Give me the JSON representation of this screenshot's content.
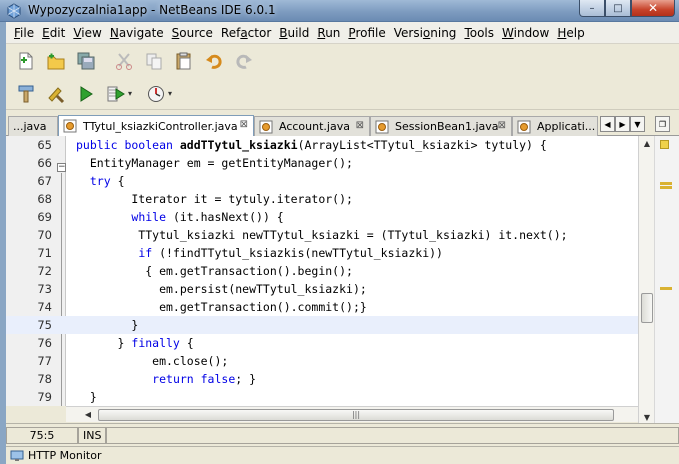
{
  "window": {
    "title": "Wypozyczalnia1app - NetBeans IDE 6.0.1",
    "minimize": "–",
    "maximize": "□",
    "close": "✕"
  },
  "menu": [
    {
      "mnemonic": "F",
      "rest": "ile"
    },
    {
      "mnemonic": "E",
      "rest": "dit"
    },
    {
      "mnemonic": "V",
      "rest": "iew"
    },
    {
      "mnemonic": "N",
      "rest": "avigate"
    },
    {
      "mnemonic": "S",
      "rest": "ource"
    },
    {
      "pre": "Ref",
      "mnemonic": "a",
      "rest": "ctor"
    },
    {
      "mnemonic": "B",
      "rest": "uild"
    },
    {
      "mnemonic": "R",
      "rest": "un"
    },
    {
      "mnemonic": "P",
      "rest": "rofile"
    },
    {
      "pre": "Versi",
      "mnemonic": "o",
      "rest": "ning"
    },
    {
      "mnemonic": "T",
      "rest": "ools"
    },
    {
      "mnemonic": "W",
      "rest": "indow"
    },
    {
      "mnemonic": "H",
      "rest": "elp"
    }
  ],
  "toolbar": {
    "row1": [
      "new-file-icon",
      "new-project-icon",
      "save-all-icon",
      "cut-icon",
      "copy-icon",
      "paste-icon",
      "undo-icon",
      "redo-icon"
    ],
    "row2": [
      "build-icon",
      "clean-build-icon",
      "run-icon",
      "debug-icon",
      "profile-icon"
    ]
  },
  "tabs": [
    {
      "label": "...java"
    },
    {
      "label": "TTytul_ksiazkiController.java",
      "active": true,
      "close": "⊠"
    },
    {
      "label": "Account.java",
      "close": "⊠"
    },
    {
      "label": "SessionBean1.java",
      "close": "⊠"
    },
    {
      "label": "Applicati..."
    }
  ],
  "editor": {
    "current_line": 75,
    "lines": [
      {
        "n": "65",
        "parts": [
          [
            "kw",
            "public boolean "
          ],
          [
            "b",
            "addTTytul_ksiazki"
          ],
          [
            "t",
            "(ArrayList<TTytul_ksiazki> tytuly) {"
          ]
        ]
      },
      {
        "n": "66",
        "parts": [
          [
            "t",
            "  EntityManager em = getEntityManager();"
          ]
        ]
      },
      {
        "n": "67",
        "parts": [
          [
            "t",
            "  "
          ],
          [
            "kw",
            "try"
          ],
          [
            "t",
            " {"
          ]
        ]
      },
      {
        "n": "68",
        "parts": [
          [
            "t",
            "        Iterator it = tytuly.iterator();"
          ]
        ]
      },
      {
        "n": "69",
        "parts": [
          [
            "t",
            "        "
          ],
          [
            "kw",
            "while"
          ],
          [
            "t",
            " (it.hasNext()) {"
          ]
        ]
      },
      {
        "n": "70",
        "parts": [
          [
            "t",
            "         TTytul_ksiazki newTTytul_ksiazki = (TTytul_ksiazki) it.next();"
          ]
        ]
      },
      {
        "n": "71",
        "parts": [
          [
            "t",
            "         "
          ],
          [
            "kw",
            "if"
          ],
          [
            "t",
            " (!findTTytul_ksiazkis(newTTytul_ksiazki))"
          ]
        ]
      },
      {
        "n": "72",
        "parts": [
          [
            "t",
            "          { em.getTransaction().begin();"
          ]
        ]
      },
      {
        "n": "73",
        "parts": [
          [
            "t",
            "            em.persist(newTTytul_ksiazki);"
          ]
        ]
      },
      {
        "n": "74",
        "parts": [
          [
            "t",
            "            em.getTransaction().commit();}"
          ]
        ]
      },
      {
        "n": "75",
        "parts": [
          [
            "t",
            "        }"
          ]
        ]
      },
      {
        "n": "76",
        "parts": [
          [
            "t",
            "      } "
          ],
          [
            "kw",
            "finally"
          ],
          [
            "t",
            " {"
          ]
        ]
      },
      {
        "n": "77",
        "parts": [
          [
            "t",
            "           em.close();"
          ]
        ]
      },
      {
        "n": "78",
        "parts": [
          [
            "t",
            "           "
          ],
          [
            "kw",
            "return false"
          ],
          [
            "t",
            "; }"
          ]
        ]
      },
      {
        "n": "79",
        "parts": [
          [
            "t",
            "  }"
          ]
        ]
      }
    ]
  },
  "statusbar": {
    "position": "75:5",
    "mode": "INS"
  },
  "bottom_panel": {
    "label": "HTTP Monitor"
  },
  "colors": {
    "keyword": "#0000e6",
    "current_line": "#e9effc",
    "error_stripe_mark": "#d9b232"
  }
}
